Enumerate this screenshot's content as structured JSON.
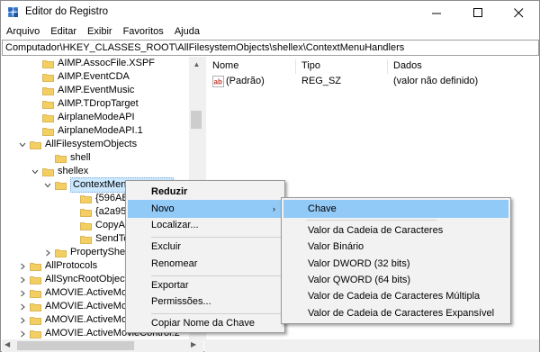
{
  "window": {
    "title": "Editor do Registro",
    "controls": {
      "minimize": "minimize-icon",
      "maximize": "maximize-icon",
      "close": "close-icon"
    }
  },
  "menubar": {
    "items": [
      {
        "label": "Arquivo"
      },
      {
        "label": "Editar"
      },
      {
        "label": "Exibir"
      },
      {
        "label": "Favoritos"
      },
      {
        "label": "Ajuda"
      }
    ]
  },
  "address": {
    "path": "Computador\\HKEY_CLASSES_ROOT\\AllFilesystemObjects\\shellex\\ContextMenuHandlers"
  },
  "tree": {
    "items": [
      {
        "label": "AIMP.AssocFile.XSPF",
        "chevron": ""
      },
      {
        "label": "AIMP.EventCDA",
        "chevron": ""
      },
      {
        "label": "AIMP.EventMusic",
        "chevron": ""
      },
      {
        "label": "AIMP.TDropTarget",
        "chevron": ""
      },
      {
        "label": "AirplaneModeAPI",
        "chevron": ""
      },
      {
        "label": "AirplaneModeAPI.1",
        "chevron": ""
      },
      {
        "label": "AllFilesystemObjects",
        "chevron": "expanded"
      },
      {
        "label": "shell",
        "chevron": ""
      },
      {
        "label": "shellex",
        "chevron": "expanded"
      },
      {
        "label": "ContextMenuHandlers",
        "chevron": "expanded"
      },
      {
        "label": "{596AB062-B4D2-4215-9F74-E9109B0A8153}",
        "chevron": ""
      },
      {
        "label": "{a2a9545d-a0c2-42b4-9708-a0b2badd77c8}",
        "chevron": ""
      },
      {
        "label": "CopyAsPathMenu",
        "chevron": ""
      },
      {
        "label": "SendTo",
        "chevron": ""
      },
      {
        "label": "PropertySheetHandlers",
        "chevron": "collapsed"
      },
      {
        "label": "AllProtocols",
        "chevron": "collapsed"
      },
      {
        "label": "AllSyncRootObjects",
        "chevron": "collapsed"
      },
      {
        "label": "AMOVIE.ActiveMovie Control",
        "chevron": "collapsed"
      },
      {
        "label": "AMOVIE.ActiveMovie Control.2",
        "chevron": "collapsed"
      },
      {
        "label": "AMOVIE.ActiveMovieControl",
        "chevron": "collapsed"
      },
      {
        "label": "AMOVIE.ActiveMovieControl.2",
        "chevron": "collapsed"
      }
    ]
  },
  "list": {
    "columns": {
      "name": "Nome",
      "type": "Tipo",
      "data": "Dados"
    },
    "rows": [
      {
        "name": "(Padrão)",
        "type": "REG_SZ",
        "data": "(valor não definido)",
        "icon": "string-value-icon"
      }
    ]
  },
  "context_menu": {
    "items": {
      "collapse": "Reduzir",
      "new": "Novo",
      "find": "Localizar...",
      "delete": "Excluir",
      "rename": "Renomear",
      "export": "Exportar",
      "permissions": "Permissões...",
      "copy_key_name": "Copiar Nome da Chave"
    }
  },
  "submenu": {
    "items": [
      {
        "label": "Chave"
      },
      {
        "label": "Valor da Cadeia de Caracteres"
      },
      {
        "label": "Valor Binário"
      },
      {
        "label": "Valor DWORD (32 bits)"
      },
      {
        "label": "Valor QWORD (64 bits)"
      },
      {
        "label": "Valor de Cadeia de Caracteres Múltipla"
      },
      {
        "label": "Valor de Cadeia de Caracteres Expansível"
      }
    ]
  },
  "colors": {
    "selection": "#cce8ff",
    "menu_hover": "#91c9f7",
    "folder": "#e8c15a"
  }
}
